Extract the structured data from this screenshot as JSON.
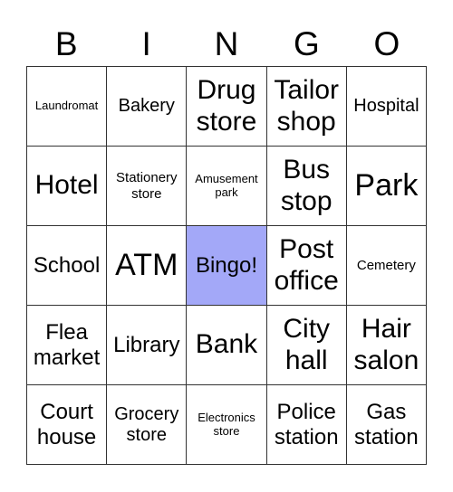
{
  "header": [
    "B",
    "I",
    "N",
    "G",
    "O"
  ],
  "free_color": "#a3a8f8",
  "cells": [
    [
      "Laundromat",
      "Bakery",
      "Drug store",
      "Tailor shop",
      "Hospital"
    ],
    [
      "Hotel",
      "Stationery store",
      "Amusement park",
      "Bus stop",
      "Park"
    ],
    [
      "School",
      "ATM",
      "Bingo!",
      "Post office",
      "Cemetery"
    ],
    [
      "Flea market",
      "Library",
      "Bank",
      "City hall",
      "Hair salon"
    ],
    [
      "Court house",
      "Grocery store",
      "Electronics store",
      "Police station",
      "Gas station"
    ]
  ]
}
